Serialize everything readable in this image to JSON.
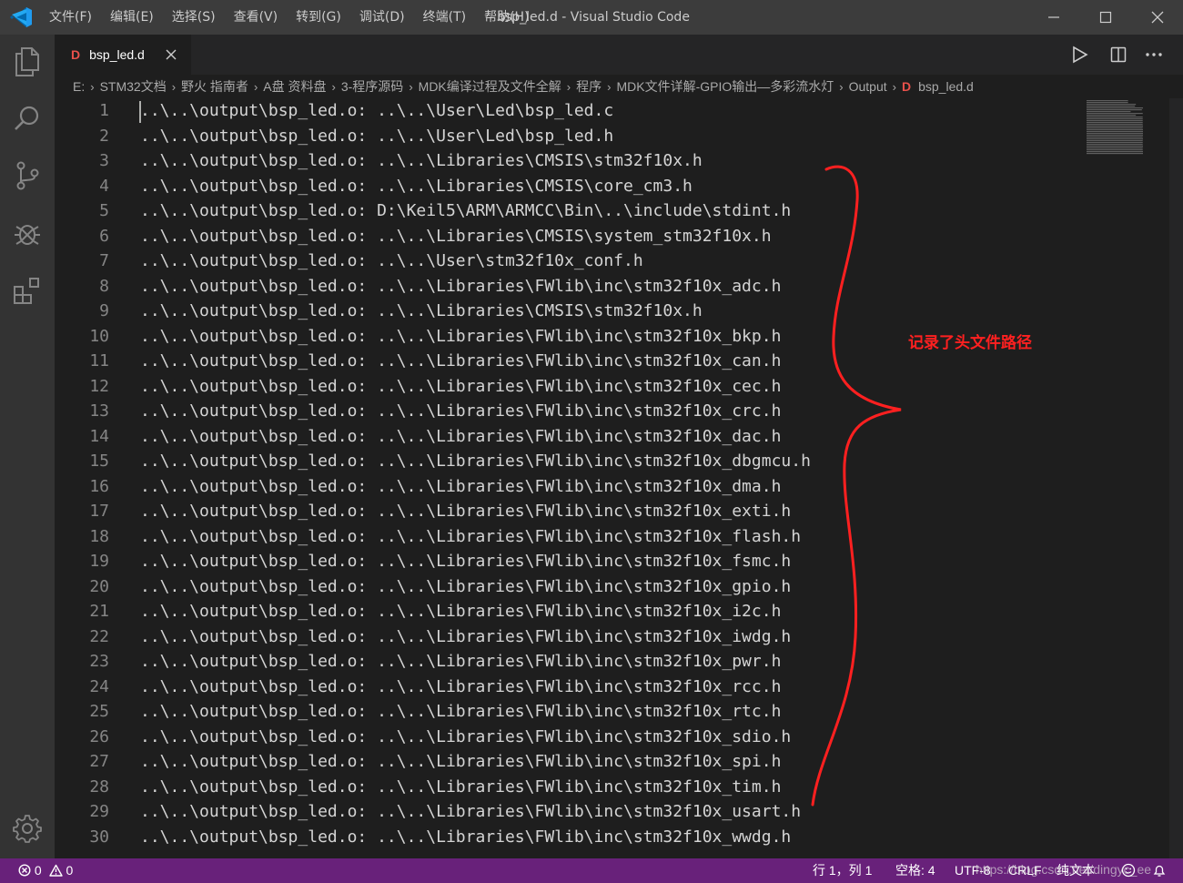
{
  "window": {
    "title": "bsp_led.d - Visual Studio Code"
  },
  "menu": {
    "items": [
      "文件(F)",
      "编辑(E)",
      "选择(S)",
      "查看(V)",
      "转到(G)",
      "调试(D)",
      "终端(T)",
      "帮助(H)"
    ]
  },
  "window_controls": {
    "icons": [
      "minimize-icon",
      "maximize-icon",
      "close-icon"
    ]
  },
  "activity_bar": {
    "icons": [
      "explorer-icon",
      "search-icon",
      "source-control-icon",
      "debug-icon",
      "extensions-icon",
      "settings-gear-icon"
    ]
  },
  "tab": {
    "icon_letter": "D",
    "label": "bsp_led.d",
    "actions": [
      "run-icon",
      "split-editor-icon",
      "more-actions-icon"
    ]
  },
  "breadcrumb": {
    "items": [
      "E:",
      "STM32文档",
      "野火 指南者",
      "A盘 资料盘",
      "3-程序源码",
      "MDK编译过程及文件全解",
      "程序",
      "MDK文件详解-GPIO输出—多彩流水灯",
      "Output",
      "bsp_led.d"
    ],
    "file_icon_letter": "D"
  },
  "editor": {
    "lines": [
      {
        "n": "1",
        "text": "..\\..\\output\\bsp_led.o: ..\\..\\User\\Led\\bsp_led.c"
      },
      {
        "n": "2",
        "text": "..\\..\\output\\bsp_led.o: ..\\..\\User\\Led\\bsp_led.h"
      },
      {
        "n": "3",
        "text": "..\\..\\output\\bsp_led.o: ..\\..\\Libraries\\CMSIS\\stm32f10x.h"
      },
      {
        "n": "4",
        "text": "..\\..\\output\\bsp_led.o: ..\\..\\Libraries\\CMSIS\\core_cm3.h"
      },
      {
        "n": "5",
        "text": "..\\..\\output\\bsp_led.o: D:\\Keil5\\ARM\\ARMCC\\Bin\\..\\include\\stdint.h"
      },
      {
        "n": "6",
        "text": "..\\..\\output\\bsp_led.o: ..\\..\\Libraries\\CMSIS\\system_stm32f10x.h"
      },
      {
        "n": "7",
        "text": "..\\..\\output\\bsp_led.o: ..\\..\\User\\stm32f10x_conf.h"
      },
      {
        "n": "8",
        "text": "..\\..\\output\\bsp_led.o: ..\\..\\Libraries\\FWlib\\inc\\stm32f10x_adc.h"
      },
      {
        "n": "9",
        "text": "..\\..\\output\\bsp_led.o: ..\\..\\Libraries\\CMSIS\\stm32f10x.h"
      },
      {
        "n": "10",
        "text": "..\\..\\output\\bsp_led.o: ..\\..\\Libraries\\FWlib\\inc\\stm32f10x_bkp.h"
      },
      {
        "n": "11",
        "text": "..\\..\\output\\bsp_led.o: ..\\..\\Libraries\\FWlib\\inc\\stm32f10x_can.h"
      },
      {
        "n": "12",
        "text": "..\\..\\output\\bsp_led.o: ..\\..\\Libraries\\FWlib\\inc\\stm32f10x_cec.h"
      },
      {
        "n": "13",
        "text": "..\\..\\output\\bsp_led.o: ..\\..\\Libraries\\FWlib\\inc\\stm32f10x_crc.h"
      },
      {
        "n": "14",
        "text": "..\\..\\output\\bsp_led.o: ..\\..\\Libraries\\FWlib\\inc\\stm32f10x_dac.h"
      },
      {
        "n": "15",
        "text": "..\\..\\output\\bsp_led.o: ..\\..\\Libraries\\FWlib\\inc\\stm32f10x_dbgmcu.h"
      },
      {
        "n": "16",
        "text": "..\\..\\output\\bsp_led.o: ..\\..\\Libraries\\FWlib\\inc\\stm32f10x_dma.h"
      },
      {
        "n": "17",
        "text": "..\\..\\output\\bsp_led.o: ..\\..\\Libraries\\FWlib\\inc\\stm32f10x_exti.h"
      },
      {
        "n": "18",
        "text": "..\\..\\output\\bsp_led.o: ..\\..\\Libraries\\FWlib\\inc\\stm32f10x_flash.h"
      },
      {
        "n": "19",
        "text": "..\\..\\output\\bsp_led.o: ..\\..\\Libraries\\FWlib\\inc\\stm32f10x_fsmc.h"
      },
      {
        "n": "20",
        "text": "..\\..\\output\\bsp_led.o: ..\\..\\Libraries\\FWlib\\inc\\stm32f10x_gpio.h"
      },
      {
        "n": "21",
        "text": "..\\..\\output\\bsp_led.o: ..\\..\\Libraries\\FWlib\\inc\\stm32f10x_i2c.h"
      },
      {
        "n": "22",
        "text": "..\\..\\output\\bsp_led.o: ..\\..\\Libraries\\FWlib\\inc\\stm32f10x_iwdg.h"
      },
      {
        "n": "23",
        "text": "..\\..\\output\\bsp_led.o: ..\\..\\Libraries\\FWlib\\inc\\stm32f10x_pwr.h"
      },
      {
        "n": "24",
        "text": "..\\..\\output\\bsp_led.o: ..\\..\\Libraries\\FWlib\\inc\\stm32f10x_rcc.h"
      },
      {
        "n": "25",
        "text": "..\\..\\output\\bsp_led.o: ..\\..\\Libraries\\FWlib\\inc\\stm32f10x_rtc.h"
      },
      {
        "n": "26",
        "text": "..\\..\\output\\bsp_led.o: ..\\..\\Libraries\\FWlib\\inc\\stm32f10x_sdio.h"
      },
      {
        "n": "27",
        "text": "..\\..\\output\\bsp_led.o: ..\\..\\Libraries\\FWlib\\inc\\stm32f10x_spi.h"
      },
      {
        "n": "28",
        "text": "..\\..\\output\\bsp_led.o: ..\\..\\Libraries\\FWlib\\inc\\stm32f10x_tim.h"
      },
      {
        "n": "29",
        "text": "..\\..\\output\\bsp_led.o: ..\\..\\Libraries\\FWlib\\inc\\stm32f10x_usart.h"
      },
      {
        "n": "30",
        "text": "..\\..\\output\\bsp_led.o: ..\\..\\Libraries\\FWlib\\inc\\stm32f10x_wwdg.h"
      }
    ]
  },
  "annotation": {
    "label": "记录了头文件路径",
    "color": "#ff2020"
  },
  "status_bar": {
    "errors": "0",
    "warnings": "0",
    "position": "行 1，列 1",
    "indent": "空格: 4",
    "encoding": "UTF-8",
    "eol": "CRLF",
    "language": "纯文本",
    "watermark": "https://blog.csdn.net/dingyc_ee",
    "color": "#68217a"
  },
  "colors": {
    "titlebar": "#3c3c3c",
    "activity_bar": "#333333",
    "editor_bg": "#1e1e1e",
    "tab_bar": "#252526",
    "line_number": "#858585",
    "text": "#d4d4d4",
    "file_icon": "#e9514b",
    "vscode_blue": "#23a9f2"
  }
}
